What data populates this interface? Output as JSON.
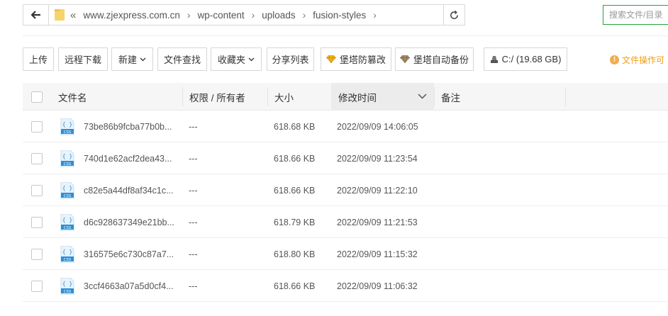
{
  "path": {
    "segments": [
      "www.zjexpress.com.cn",
      "wp-content",
      "uploads",
      "fusion-styles"
    ]
  },
  "search": {
    "placeholder": "搜索文件/目录"
  },
  "toolbar": {
    "upload": "上传",
    "remote_download": "远程下载",
    "new": "新建",
    "file_search": "文件查找",
    "favorites": "收藏夹",
    "share_list": "分享列表",
    "tamper_protect": "堡塔防篡改",
    "auto_backup": "堡塔自动备份",
    "disk": "C:/ (19.68 GB)",
    "warning": "文件操作可"
  },
  "table": {
    "headers": {
      "name": "文件名",
      "perm_owner": "权限 / 所有者",
      "size": "大小",
      "modified": "修改时间",
      "note": "备注"
    },
    "rows": [
      {
        "name": "73be86b9fcba77b0b...",
        "perm": "---",
        "size": "618.68 KB",
        "modified": "2022/09/09 14:06:05",
        "note": ""
      },
      {
        "name": "740d1e62acf2dea43...",
        "perm": "---",
        "size": "618.66 KB",
        "modified": "2022/09/09 11:23:54",
        "note": ""
      },
      {
        "name": "c82e5a44df8af34c1c...",
        "perm": "---",
        "size": "618.66 KB",
        "modified": "2022/09/09 11:22:10",
        "note": ""
      },
      {
        "name": "d6c928637349e21bb...",
        "perm": "---",
        "size": "618.79 KB",
        "modified": "2022/09/09 11:21:53",
        "note": ""
      },
      {
        "name": "316575e6c730c87a7...",
        "perm": "---",
        "size": "618.80 KB",
        "modified": "2022/09/09 11:15:32",
        "note": ""
      },
      {
        "name": "3ccf4663a07a5d0cf4...",
        "perm": "---",
        "size": "618.66 KB",
        "modified": "2022/09/09 11:06:32",
        "note": ""
      }
    ]
  },
  "icons": {
    "back": "arrow-left-icon",
    "folder": "folder-icon",
    "refresh": "refresh-icon",
    "file": "css-file-icon",
    "gem": "gem-icon",
    "disk": "disk-icon",
    "info": "info-icon"
  },
  "colors": {
    "accent": "#20a53a",
    "warning": "#f39c12",
    "css_icon": "#2b8fd6",
    "gem": "#e6a817"
  }
}
